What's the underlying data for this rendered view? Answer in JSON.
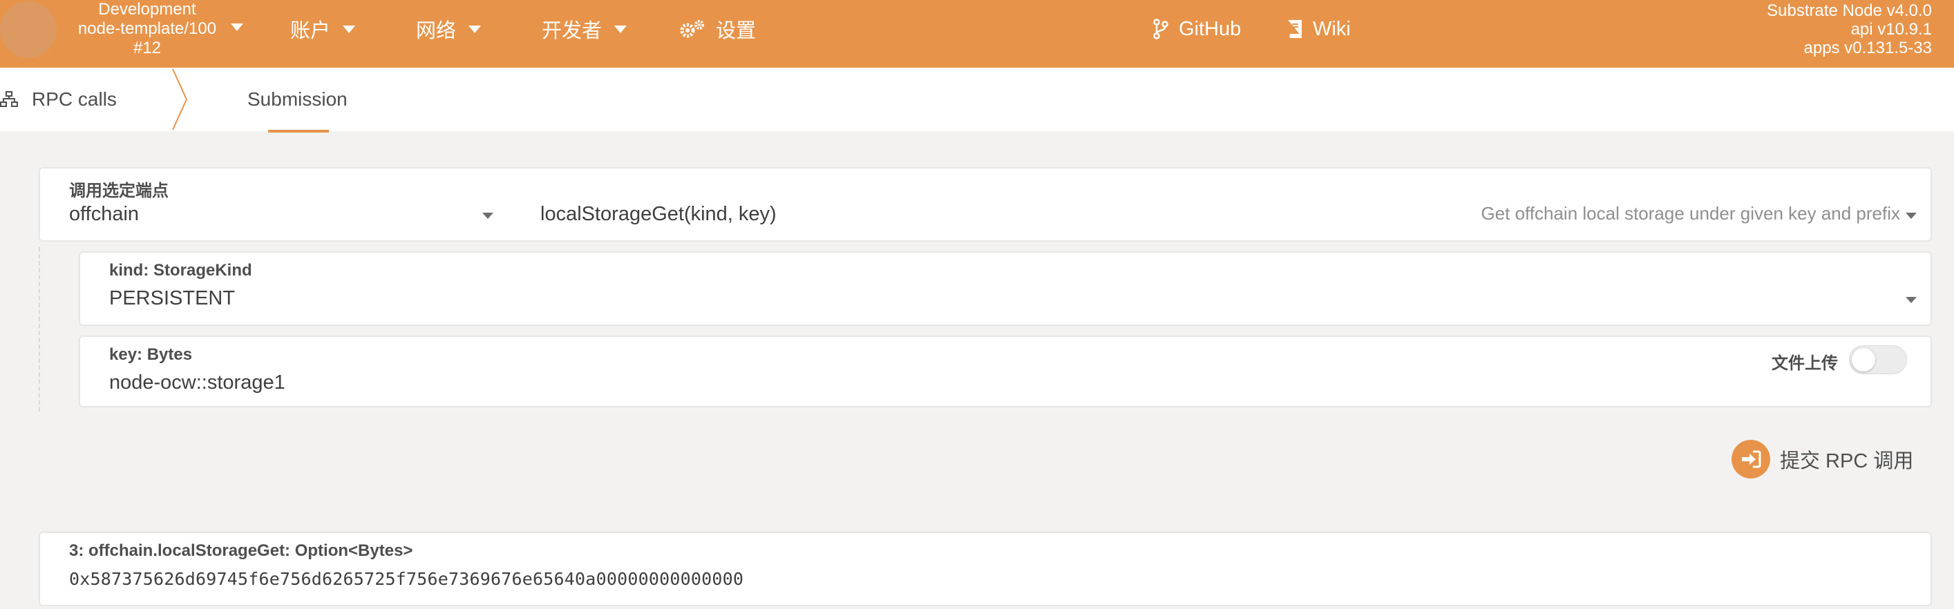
{
  "header": {
    "chain_name": "Development",
    "node_name": "node-template/100",
    "block": "#12",
    "menu": {
      "accounts": "账户",
      "network": "网络",
      "developer": "开发者",
      "settings": "设置"
    },
    "links": {
      "github": "GitHub",
      "wiki": "Wiki"
    },
    "version": {
      "node": "Substrate Node v4.0.0",
      "api": "api v10.9.1",
      "apps": "apps v0.131.5-33"
    },
    "colors": {
      "brand": "#e7944a"
    }
  },
  "tabs": {
    "rpc_calls": "RPC calls",
    "submission": "Submission"
  },
  "endpoint": {
    "label": "调用选定端点",
    "section": "offchain",
    "method": "localStorageGet(kind, key)",
    "description": "Get offchain local storage under given key and prefix"
  },
  "params": {
    "kind": {
      "label": "kind: StorageKind",
      "value": "PERSISTENT"
    },
    "key": {
      "label": "key: Bytes",
      "value": "node-ocw::storage1",
      "file_upload_label": "文件上传",
      "file_upload_enabled": false
    }
  },
  "submit": {
    "label": "提交 RPC 调用"
  },
  "result": {
    "label": "3: offchain.localStorageGet: Option<Bytes>",
    "value": "0x587375626d69745f6e756d6265725f756e7369676e65640a00000000000000"
  }
}
